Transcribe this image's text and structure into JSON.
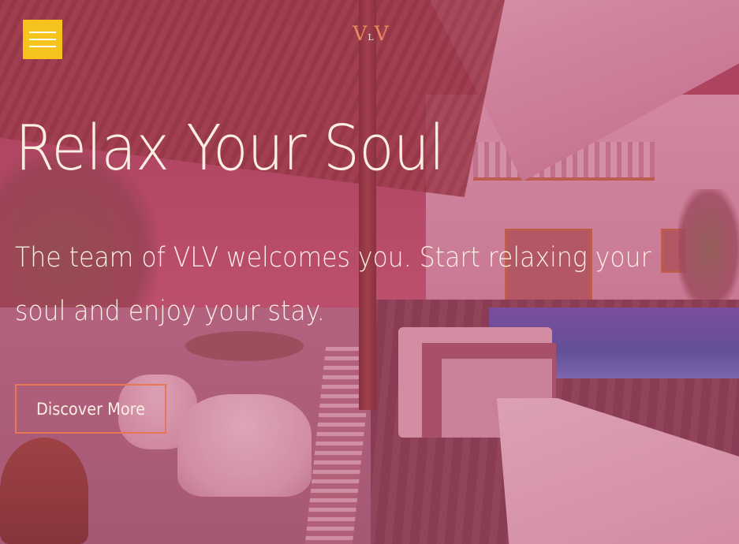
{
  "header": {
    "menu_icon": "hamburger-menu-icon",
    "menu_color": "#f6c21c",
    "logo": {
      "left": "V",
      "middle": "L",
      "right": "V",
      "color": "#e98a5a"
    }
  },
  "hero": {
    "title": "Relax Your Soul",
    "subtitle": "The team of VLV welcomes you. Start relaxing your soul and enjoy your stay.",
    "cta_label": "Discover More",
    "cta_border_color": "#e67855",
    "text_color": "#fbefe4"
  }
}
